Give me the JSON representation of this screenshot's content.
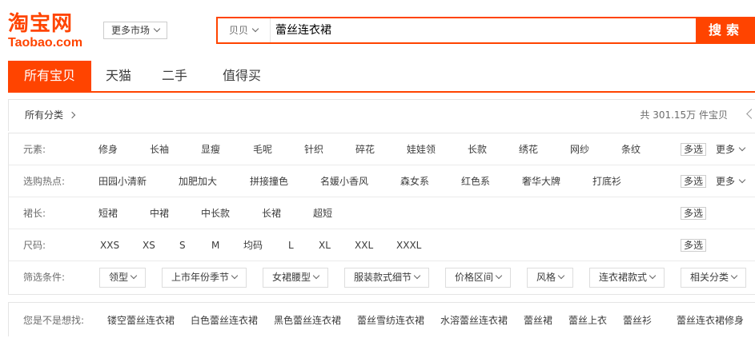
{
  "logo": {
    "main": "淘宝网",
    "sub": "Taobao.com"
  },
  "header": {
    "more_market": "更多市场"
  },
  "search": {
    "type_label": "贝贝",
    "query": "蕾丝连衣裙",
    "button": "搜索"
  },
  "tabs": [
    {
      "label": "所有宝贝",
      "active": true
    },
    {
      "label": "天猫",
      "active": false
    },
    {
      "label": "二手",
      "active": false
    },
    {
      "label": "值得买",
      "active": false
    }
  ],
  "category": {
    "all_label": "所有分类",
    "total": "共 301.15万 件宝贝"
  },
  "filters": {
    "element": {
      "label": "元素:",
      "values": [
        "修身",
        "长袖",
        "显瘦",
        "毛呢",
        "针织",
        "碎花",
        "娃娃领",
        "长款",
        "绣花",
        "网纱",
        "条纹"
      ],
      "multi": "多选",
      "more": "更多"
    },
    "hot": {
      "label": "选购热点:",
      "values": [
        "田园小清新",
        "加肥加大",
        "拼接撞色",
        "名媛小香风",
        "森女系",
        "红色系",
        "奢华大牌",
        "打底衫"
      ],
      "multi": "多选",
      "more": "更多"
    },
    "length": {
      "label": "裙长:",
      "values": [
        "短裙",
        "中裙",
        "中长款",
        "长裙",
        "超短"
      ],
      "multi": "多选"
    },
    "size": {
      "label": "尺码:",
      "values": [
        "XXS",
        "XS",
        "S",
        "M",
        "均码",
        "L",
        "XL",
        "XXL",
        "XXXL"
      ],
      "multi": "多选"
    },
    "conditions": {
      "label": "筛选条件:",
      "dropdowns": [
        "领型",
        "上市年份季节",
        "女裙腰型",
        "服装款式细节",
        "价格区间",
        "风格",
        "连衣裙款式",
        "相关分类"
      ]
    }
  },
  "suggestions": {
    "label": "您是不是想找:",
    "items": [
      "镂空蕾丝连衣裙",
      "白色蕾丝连衣裙",
      "黑色蕾丝连衣裙",
      "蕾丝雪纺连衣裙",
      "水溶蕾丝连衣裙",
      "蕾丝裙",
      "蕾丝上衣",
      "蕾丝衫",
      "蕾丝连衣裙修身"
    ]
  },
  "colors": {
    "brand": "#ff4400",
    "border": "#e5e5e5",
    "text": "#3c3c3c",
    "muted": "#6c6c6c"
  }
}
